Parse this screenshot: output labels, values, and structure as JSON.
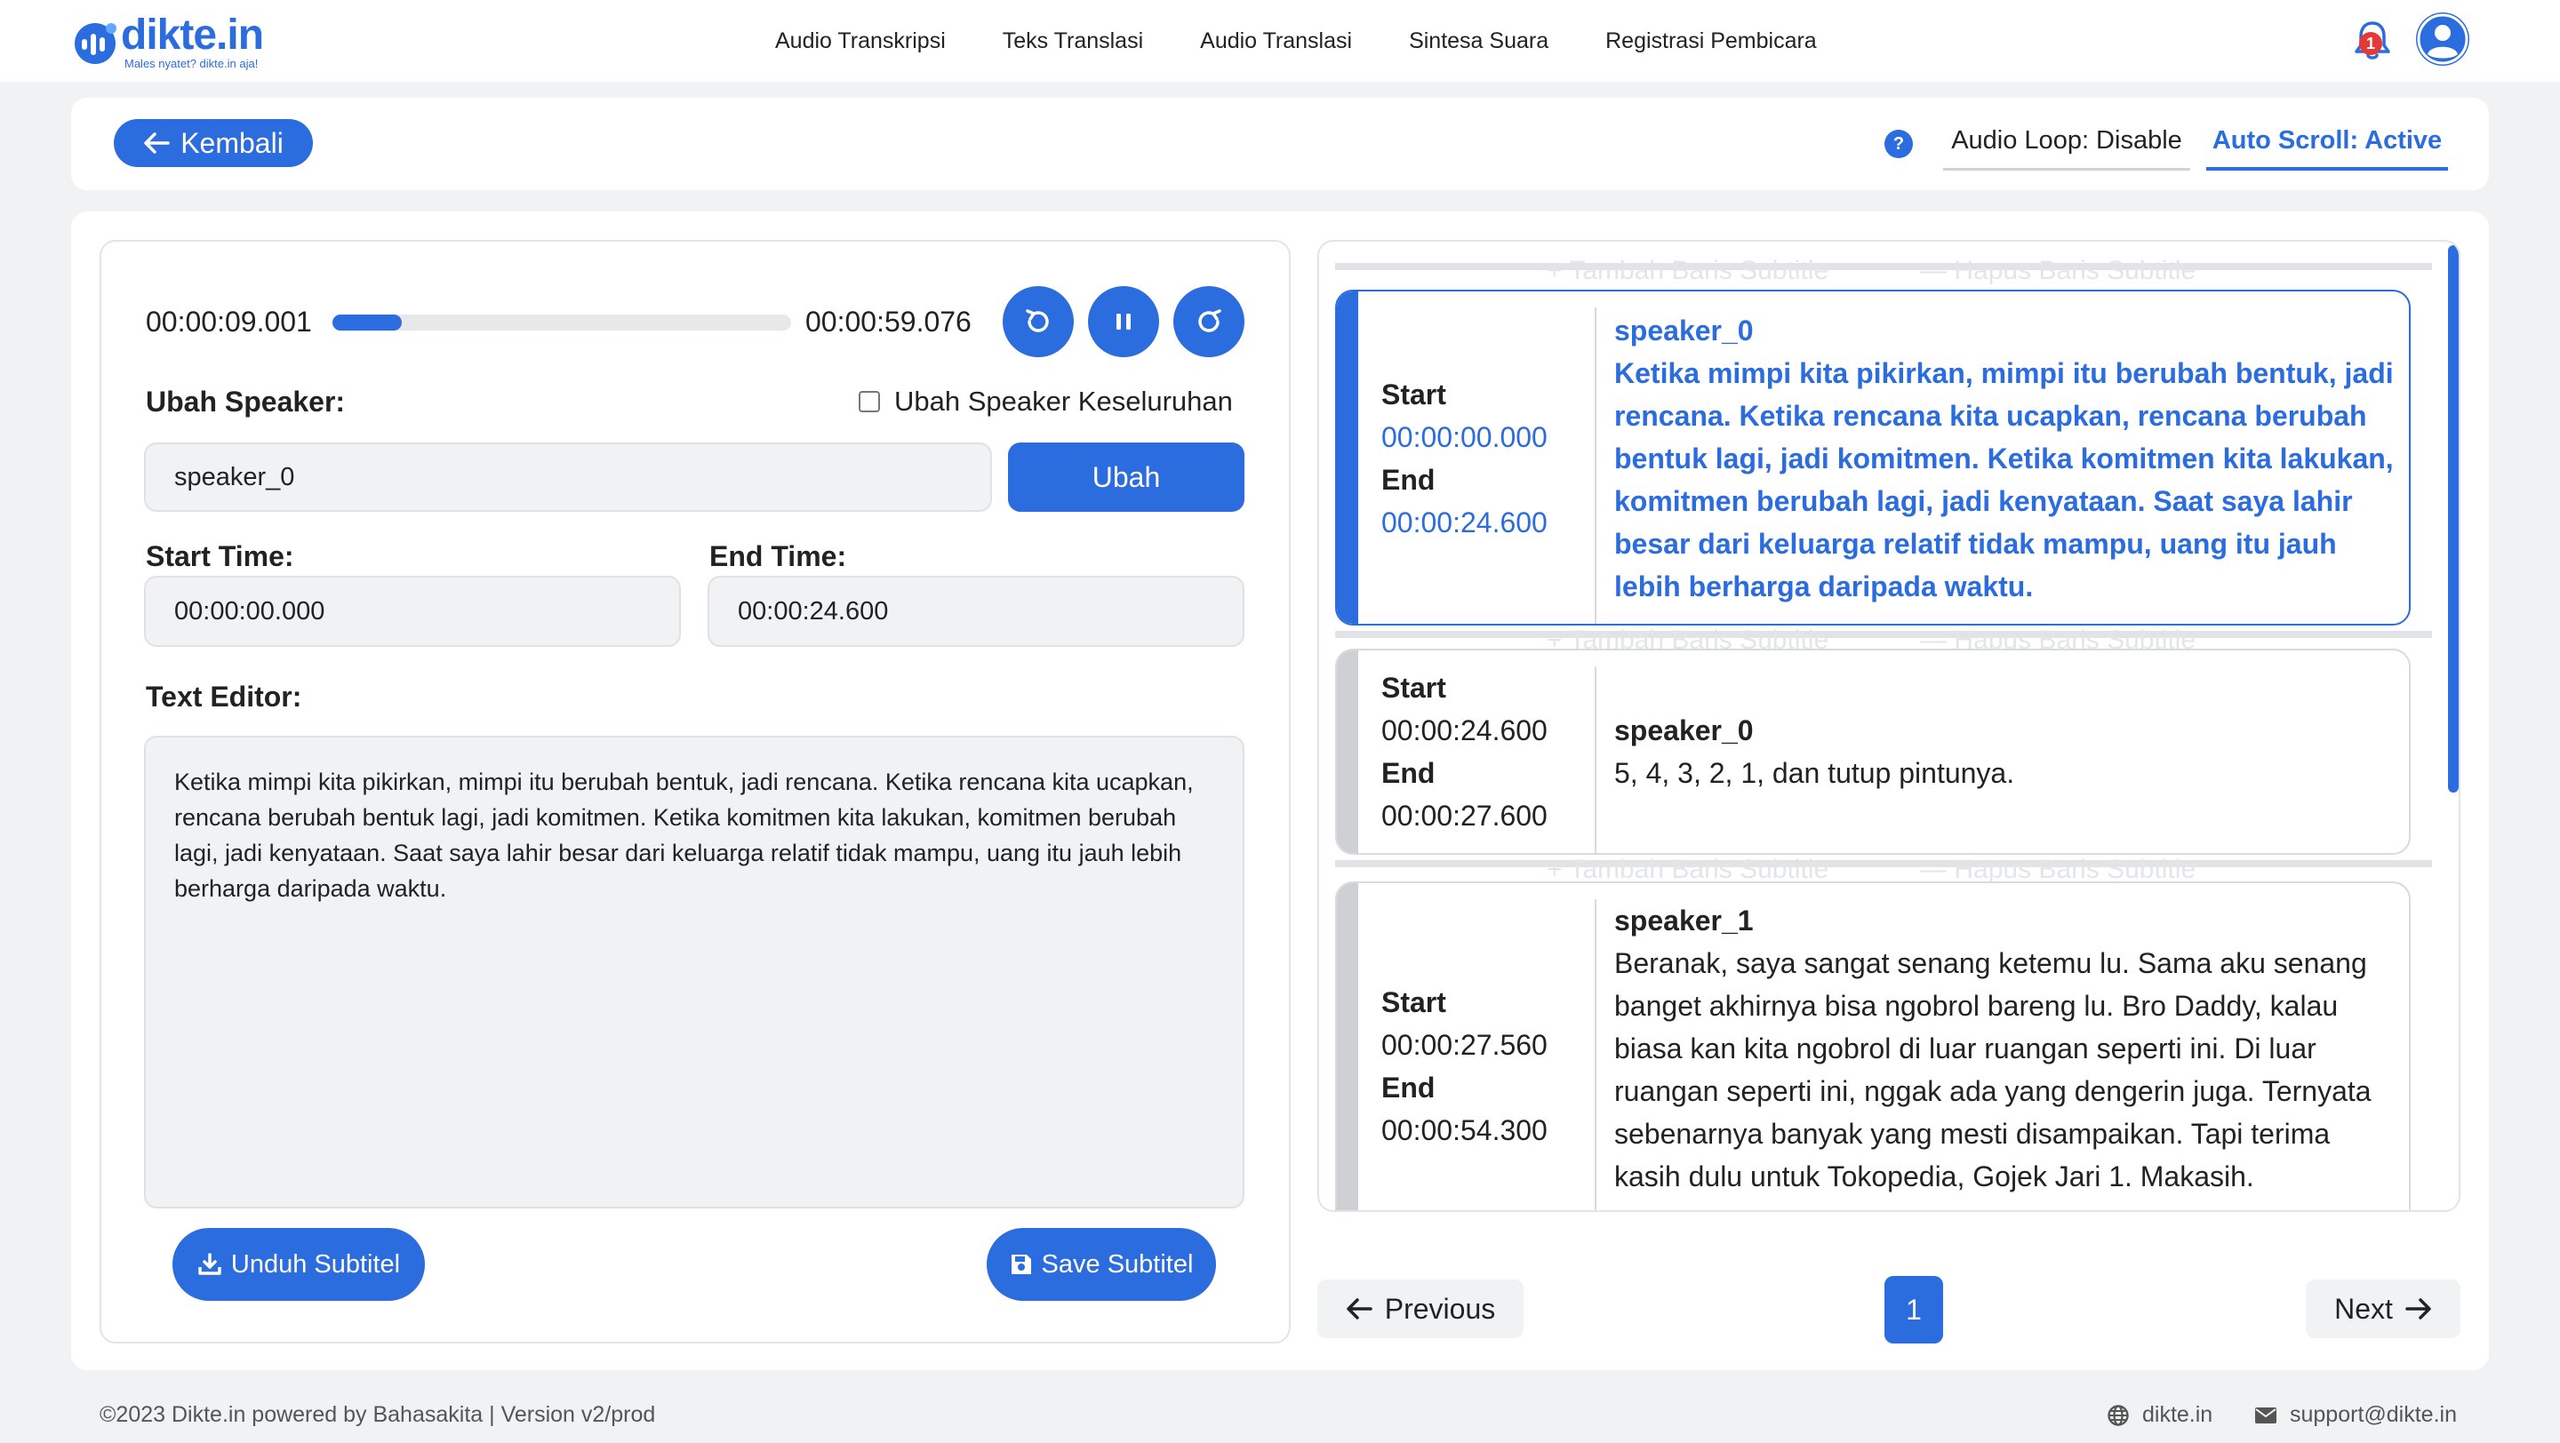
{
  "brand": {
    "name": "dikte.in",
    "tagline": "Males nyatet? dikte.in aja!"
  },
  "nav": {
    "links": [
      "Audio Transkripsi",
      "Teks Translasi",
      "Audio Translasi",
      "Sintesa Suara",
      "Registrasi Pembicara"
    ],
    "notification_count": "1"
  },
  "topbar": {
    "back_label": "Kembali",
    "help_glyph": "?",
    "audio_loop": "Audio Loop: Disable",
    "auto_scroll": "Auto Scroll: Active"
  },
  "player": {
    "current_time": "00:00:09.001",
    "total_time": "00:00:59.076",
    "progress_fraction": 0.152
  },
  "editor": {
    "speaker_label": "Ubah Speaker:",
    "speaker_all_label": "Ubah Speaker Keseluruhan",
    "speaker_all_checked": false,
    "speaker_value": "speaker_0",
    "ubah_label": "Ubah",
    "start_label": "Start Time:",
    "start_value": "00:00:00.000",
    "end_label": "End Time:",
    "end_value": "00:00:24.600",
    "text_label": "Text Editor:",
    "text_value": "Ketika mimpi kita pikirkan, mimpi itu berubah bentuk, jadi rencana. Ketika rencana kita ucapkan, rencana berubah bentuk lagi, jadi komitmen. Ketika komitmen kita lakukan, komitmen berubah lagi, jadi kenyataan. Saat saya lahir besar dari keluarga relatif tidak mampu, uang itu jauh lebih berharga daripada waktu.",
    "download_label": "Unduh Subtitel",
    "save_label": "Save Subtitel"
  },
  "subtitle_actions": {
    "add": "Tambah Baris Subtitle",
    "remove": "Hapus Baris Subtitle"
  },
  "subtitles": [
    {
      "start_label": "Start",
      "start": "00:00:00.000",
      "end_label": "End",
      "end": "00:00:24.600",
      "speaker": "speaker_0",
      "text": "Ketika mimpi kita pikirkan, mimpi itu berubah bentuk, jadi rencana. Ketika rencana kita ucapkan, rencana berubah bentuk lagi, jadi komitmen. Ketika komitmen kita lakukan, komitmen berubah lagi, jadi kenyataan. Saat saya lahir besar dari keluarga relatif tidak mampu, uang itu jauh lebih berharga daripada waktu."
    },
    {
      "start_label": "Start",
      "start": "00:00:24.600",
      "end_label": "End",
      "end": "00:00:27.600",
      "speaker": "speaker_0",
      "text": "5, 4, 3, 2, 1, dan tutup pintunya."
    },
    {
      "start_label": "Start",
      "start": "00:00:27.560",
      "end_label": "End",
      "end": "00:00:54.300",
      "speaker": "speaker_1",
      "text": "Beranak, saya sangat senang ketemu lu. Sama aku senang banget akhirnya bisa ngobrol bareng lu. Bro Daddy, kalau biasa kan kita ngobrol di luar ruangan seperti ini. Di luar ruangan seperti ini, nggak ada yang dengerin juga. Ternyata sebenarnya banyak yang mesti disampaikan. Tapi terima kasih dulu untuk Tokopedia, Gojek Jari 1. Makasih."
    }
  ],
  "pagination": {
    "previous": "Previous",
    "page": "1",
    "next": "Next"
  },
  "footer": {
    "copyright": "©2023 Dikte.in powered by Bahasakita | Version v2/prod",
    "website": "dikte.in",
    "email": "support@dikte.in"
  },
  "colors": {
    "accent": "#2b6cde",
    "badge": "#e53935",
    "page_bg": "#f1f2f4"
  },
  "icons": [
    "arrow-left-icon",
    "help-icon",
    "bell-icon",
    "user-icon",
    "rewind-icon",
    "pause-icon",
    "forward-icon",
    "download-icon",
    "floppy-disk-icon",
    "plus-icon",
    "minus-icon",
    "arrow-right-icon",
    "globe-icon",
    "envelope-icon"
  ]
}
